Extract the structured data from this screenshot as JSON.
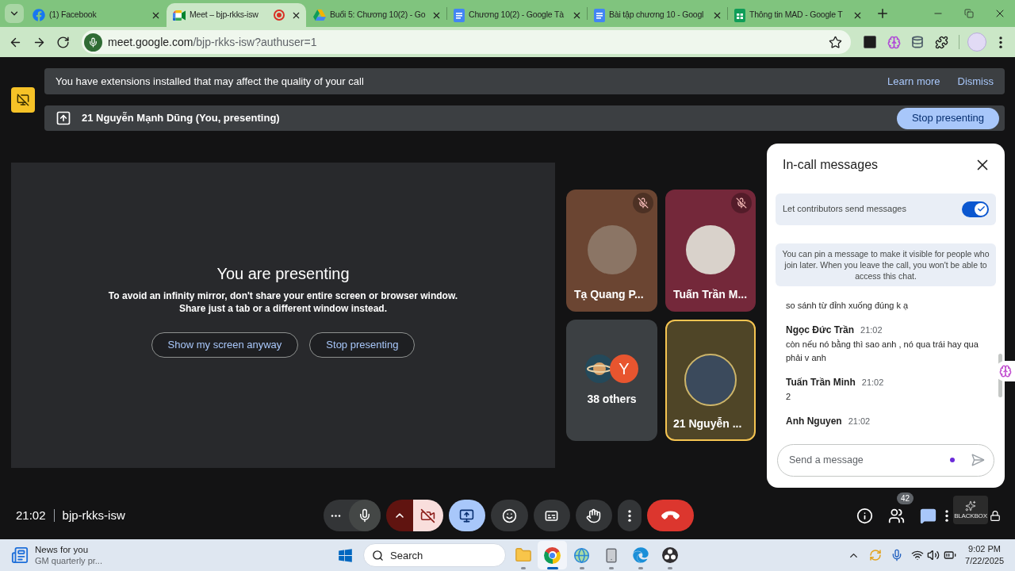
{
  "browser": {
    "tabs": [
      {
        "kind": "facebook",
        "title": "(1) Facebook",
        "selected": false,
        "recording": false
      },
      {
        "kind": "meet",
        "title": "Meet – bjp-rkks-isw",
        "selected": true,
        "recording": true
      },
      {
        "kind": "drive",
        "title": "Buổi 5: Chương 10(2) - Go",
        "selected": false,
        "recording": false
      },
      {
        "kind": "docs",
        "title": "Chương 10(2) - Google Tà",
        "selected": false,
        "recording": false
      },
      {
        "kind": "docs",
        "title": "Bài tập chương 10 - Googl",
        "selected": false,
        "recording": false
      },
      {
        "kind": "sheets",
        "title": "Thông tin MAD - Google T",
        "selected": false,
        "recording": false
      }
    ],
    "address": {
      "host": "meet.google.com",
      "path": "/bjp-rkks-isw?authuser=1"
    }
  },
  "banners": [
    {
      "kind": "notice",
      "text": "You have extensions installed that may affect the quality of your call",
      "actions": [
        "Learn more",
        "Dismiss"
      ]
    },
    {
      "kind": "presenting",
      "text": "21 Nguyễn Mạnh Dũng (You, presenting)",
      "actions": [
        "Stop presenting"
      ]
    }
  ],
  "presentation": {
    "title": "You are presenting",
    "lines": [
      "To avoid an infinity mirror, don't share your entire screen or browser window.",
      "Share just a tab or a different window instead."
    ],
    "buttons": [
      "Show my screen anyway",
      "Stop presenting"
    ]
  },
  "participants": [
    {
      "kind": "person",
      "name": "Tạ Quang P...",
      "color": "#6b4532",
      "muted": true,
      "highlighted": false
    },
    {
      "kind": "person",
      "name": "Tuấn Trần M...",
      "color": "#74283a",
      "muted": true,
      "highlighted": false
    },
    {
      "kind": "group",
      "name": "38 others",
      "color": "#3c4043",
      "avatars": [
        {
          "kind": "picture"
        },
        {
          "kind": "letter",
          "letter": "Y",
          "color": "#e8552f"
        }
      ],
      "muted": false,
      "highlighted": false
    },
    {
      "kind": "person",
      "name": "21 Nguyễn ...",
      "color": "#4f4527",
      "muted": false,
      "highlighted": true
    }
  ],
  "chat": {
    "title": "In-call messages",
    "setting": {
      "label": "Let contributors send messages",
      "on": true
    },
    "info": "You can pin a message to make it visible for people who join later. When you leave the call, you won't be able to access this chat.",
    "messages": [
      {
        "text": "so sánh từ đỉnh xuống đúng k ạ"
      },
      {
        "sender": "Ngọc Đức Trần",
        "time": "21:02",
        "text": "còn nếu nó bằng thì sao anh , nó qua trái hay qua phải v anh"
      },
      {
        "sender": "Tuấn Trần Minh",
        "time": "21:02",
        "text": "2"
      },
      {
        "sender": "Anh Nguyen",
        "time": "21:02"
      }
    ],
    "input": {
      "placeholder": "Send a message"
    }
  },
  "meeting_bar": {
    "time": "21:02",
    "code": "bjp-rkks-isw",
    "controls": [
      {
        "kind": "audio",
        "on": true
      },
      {
        "kind": "camera",
        "on": false
      },
      {
        "kind": "present",
        "on": true
      },
      {
        "kind": "reactions"
      },
      {
        "kind": "captions"
      },
      {
        "kind": "raise_hand"
      },
      {
        "kind": "more"
      },
      {
        "kind": "leave"
      }
    ],
    "people_count": "42",
    "chat_open": true,
    "recorder_label": "BLACKBOX"
  },
  "taskbar": {
    "news": {
      "title": "News for you",
      "subtitle": "GM quarterly pr..."
    },
    "search": {
      "placeholder": "Search"
    },
    "apps": [
      {
        "kind": "folder",
        "running": true,
        "selected": false
      },
      {
        "kind": "chrome",
        "running": true,
        "selected": true
      },
      {
        "kind": "globe",
        "running": true,
        "selected": false
      },
      {
        "kind": "device",
        "running": true,
        "selected": false
      },
      {
        "kind": "edge",
        "running": true,
        "selected": false
      },
      {
        "kind": "obs",
        "running": true,
        "selected": false
      }
    ],
    "clock": {
      "time": "9:02 PM",
      "date": "7/22/2025"
    }
  }
}
